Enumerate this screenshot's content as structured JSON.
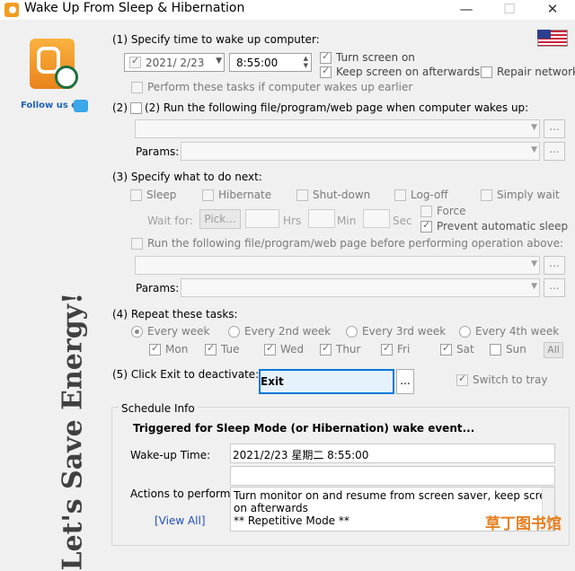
{
  "window": {
    "title": "Wake Up From Sleep & Hibernation",
    "controls": [
      "—",
      "☐",
      "✕"
    ]
  },
  "branding": {
    "follow_text": "Follow us on",
    "slogan": "Let's Save Energy!"
  },
  "section1": {
    "label": "(1) Specify time to wake up computer:",
    "date_value": "2021/ 2/23",
    "time_value": "8:55:00",
    "turn_screen_on": "Turn screen on",
    "keep_screen_on": "Keep screen on afterwards",
    "repair_network": "Repair network",
    "perform_if_earlier": "Perform these tasks if computer wakes up earlier"
  },
  "section2": {
    "label": "(2) Run the following file/program/web page when computer wakes up:",
    "params_label": "Params:",
    "dots": "..."
  },
  "section3": {
    "label": "(3) Specify what to do next:",
    "options": [
      "Sleep",
      "Hibernate",
      "Shut-down",
      "Log-off",
      "Simply wait"
    ],
    "wait_for": "Wait for:",
    "pick": "Pick...",
    "hrs": "Hrs",
    "min": "Min",
    "sec": "Sec",
    "force": "Force",
    "prevent_sleep": "Prevent automatic sleep",
    "run_before": "Run the following file/program/web page before performing operation above:",
    "params_label": "Params:",
    "dots": "..."
  },
  "section4": {
    "label": "(4) Repeat these tasks:",
    "repeat_options": [
      "Every week",
      "Every 2nd week",
      "Every 3rd week",
      "Every 4th week"
    ],
    "days": [
      "Mon",
      "Tue",
      "Wed",
      "Thur",
      "Fri",
      "Sat",
      "Sun"
    ],
    "all": "All"
  },
  "section5": {
    "label": "(5) Click Exit to deactivate:",
    "exit": "Exit",
    "dots": "...",
    "switch_to_tray": "Switch to tray"
  },
  "schedule": {
    "legend": "Schedule Info",
    "heading": "Triggered for Sleep Mode (or Hibernation) wake event...",
    "wakeup_label": "Wake-up Time:",
    "wakeup_value": "2021/2/23 星期二 8:55:00",
    "actions_label": "Actions to perform:",
    "actions_line1": "Turn monitor on and resume from screen saver, keep screen",
    "actions_line2": "on afterwards",
    "actions_line3": "** Repetitive Mode **",
    "view_all": "[View All]"
  },
  "watermark": "草丁图书馆",
  "colors": {
    "accent": "#0078d7",
    "logo_orange": "#f39b1e",
    "link_blue": "#1f62b5"
  }
}
